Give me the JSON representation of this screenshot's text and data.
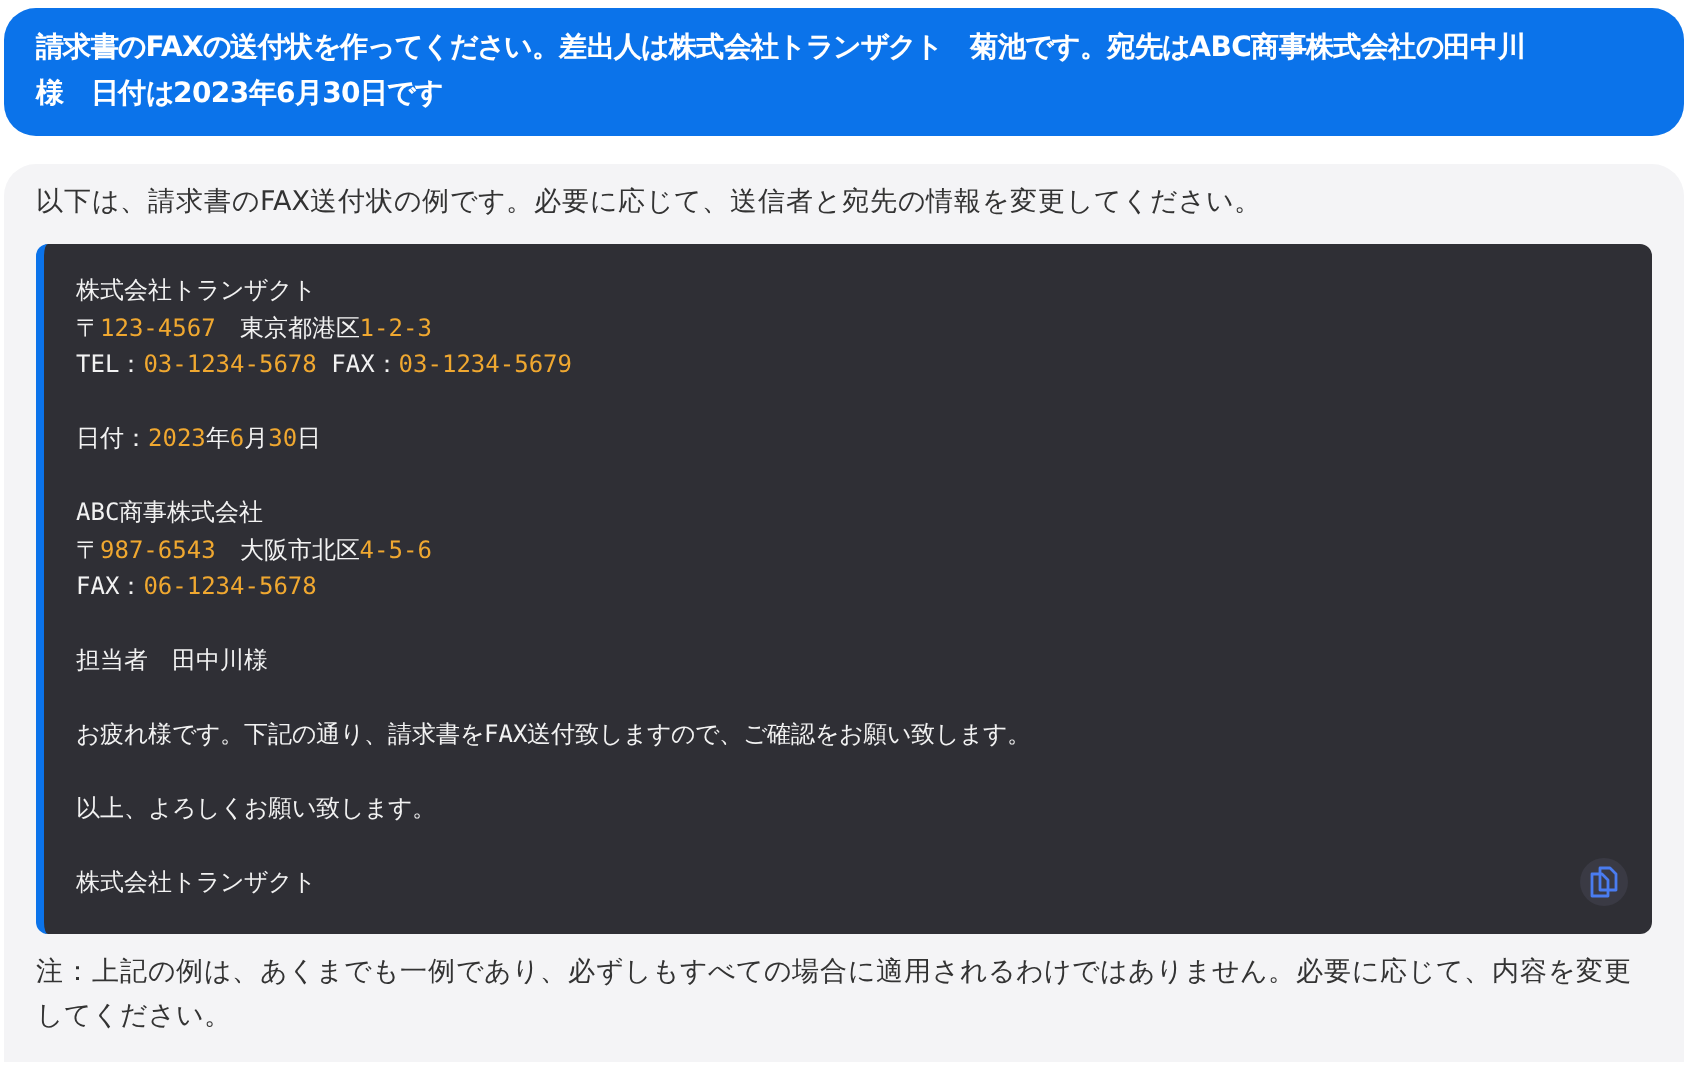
{
  "user_message": "請求書のFAXの送付状を作ってください。差出人は株式会社トランザクト　菊池です。宛先はABC商事株式会社の田中川様　日付は2023年6月30日です",
  "answer": {
    "intro": "以下は、請求書のFAX送付状の例です。必要に応じて、送信者と宛先の情報を変更してください。",
    "code_lines": [
      {
        "kind": "text",
        "segments": [
          {
            "text": "株式会社トランザクト",
            "highlight": false
          }
        ]
      },
      {
        "kind": "text",
        "segments": [
          {
            "text": "〒",
            "highlight": false
          },
          {
            "text": "123-4567",
            "highlight": true
          },
          {
            "text": "　東京都港区",
            "highlight": false
          },
          {
            "text": "1-2-3",
            "highlight": true
          }
        ]
      },
      {
        "kind": "text",
        "segments": [
          {
            "text": "TEL：",
            "highlight": false
          },
          {
            "text": "03-1234-5678",
            "highlight": true
          },
          {
            "text": " FAX：",
            "highlight": false
          },
          {
            "text": "03-1234-5679",
            "highlight": true
          }
        ]
      },
      {
        "kind": "blank"
      },
      {
        "kind": "text",
        "segments": [
          {
            "text": "日付：",
            "highlight": false
          },
          {
            "text": "2023",
            "highlight": true
          },
          {
            "text": "年",
            "highlight": false
          },
          {
            "text": "6",
            "highlight": true
          },
          {
            "text": "月",
            "highlight": false
          },
          {
            "text": "30",
            "highlight": true
          },
          {
            "text": "日",
            "highlight": false
          }
        ]
      },
      {
        "kind": "blank"
      },
      {
        "kind": "text",
        "segments": [
          {
            "text": "ABC商事株式会社",
            "highlight": false
          }
        ]
      },
      {
        "kind": "text",
        "segments": [
          {
            "text": "〒",
            "highlight": false
          },
          {
            "text": "987-6543",
            "highlight": true
          },
          {
            "text": "　大阪市北区",
            "highlight": false
          },
          {
            "text": "4-5-6",
            "highlight": true
          }
        ]
      },
      {
        "kind": "text",
        "segments": [
          {
            "text": "FAX：",
            "highlight": false
          },
          {
            "text": "06-1234-5678",
            "highlight": true
          }
        ]
      },
      {
        "kind": "blank"
      },
      {
        "kind": "text",
        "segments": [
          {
            "text": "担当者　田中川様",
            "highlight": false
          }
        ]
      },
      {
        "kind": "blank"
      },
      {
        "kind": "text",
        "segments": [
          {
            "text": "お疲れ様です。下記の通り、請求書をFAX送付致しますので、ご確認をお願い致します。",
            "highlight": false
          }
        ]
      },
      {
        "kind": "blank"
      },
      {
        "kind": "text",
        "segments": [
          {
            "text": "以上、よろしくお願い致します。",
            "highlight": false
          }
        ]
      },
      {
        "kind": "blank"
      },
      {
        "kind": "text",
        "segments": [
          {
            "text": "株式会社トランザクト",
            "highlight": false
          }
        ]
      }
    ],
    "note": "注：上記の例は、あくまでも一例であり、必ずしもすべての場合に適用されるわけではありません。必要に応じて、内容を変更してください。"
  }
}
